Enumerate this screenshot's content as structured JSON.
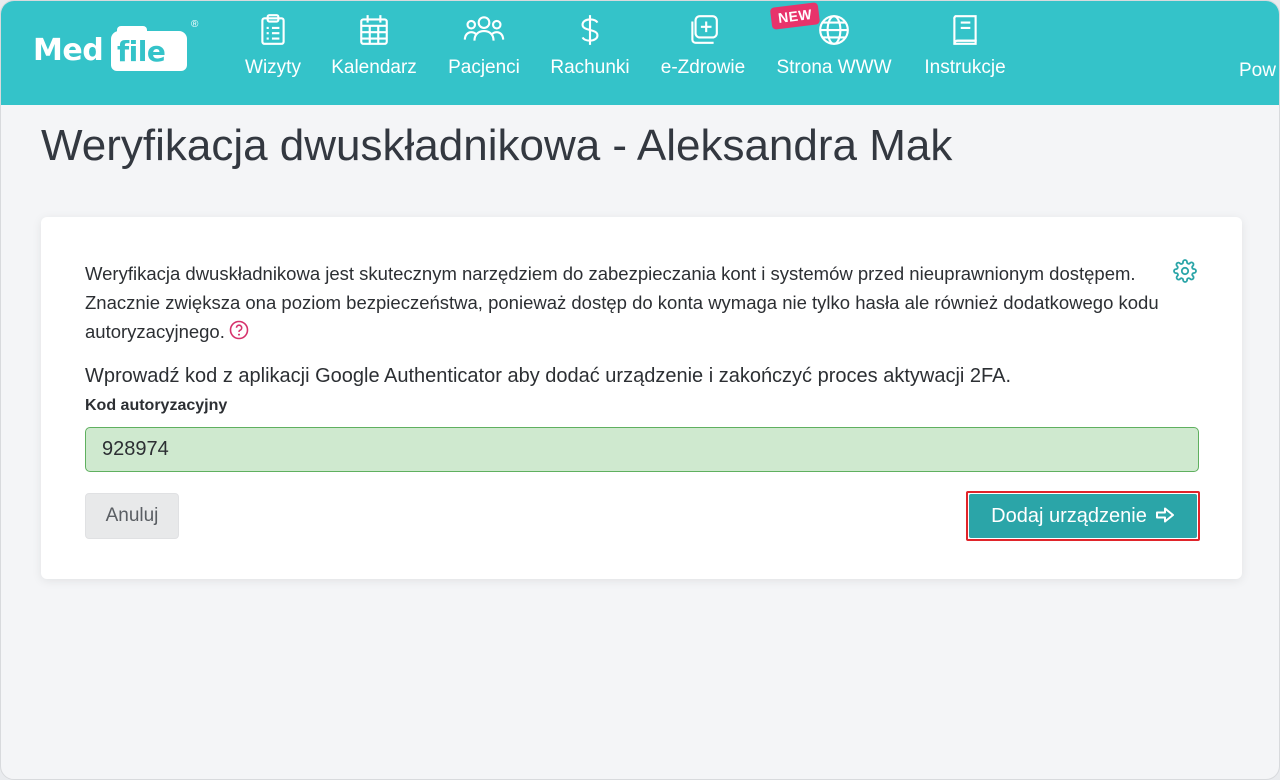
{
  "brand": {
    "logo_part1": "Med",
    "logo_part2": "file",
    "registered": "®"
  },
  "nav": {
    "items": [
      {
        "label": "Wizyty",
        "icon": "clipboard-icon"
      },
      {
        "label": "Kalendarz",
        "icon": "calendar-icon"
      },
      {
        "label": "Pacjenci",
        "icon": "users-icon"
      },
      {
        "label": "Rachunki",
        "icon": "dollar-icon"
      },
      {
        "label": "e-Zdrowie",
        "icon": "medical-plus-icon"
      },
      {
        "label": "Strona WWW",
        "icon": "globe-icon"
      },
      {
        "label": "Instrukcje",
        "icon": "book-icon"
      }
    ],
    "new_badge": "NEW",
    "cut_off_label": "Pow"
  },
  "page": {
    "title": "Weryfikacja dwuskładnikowa - Aleksandra Mak"
  },
  "card": {
    "description": "Weryfikacja dwuskładnikowa jest skutecznym narzędziem do zabezpieczania kont i systemów przed nieuprawnionym dostępem. Znacznie zwiększa ona poziom bezpieczeństwa, ponieważ dostęp do konta wymaga nie tylko hasła ale również dodatkowego kodu autoryzacyjnego.",
    "instruction": "Wprowadź kod z aplikacji Google Authenticator aby dodać urządzenie i zakończyć proces aktywacji 2FA.",
    "code_label": "Kod autoryzacyjny",
    "code_value": "928974",
    "cancel_label": "Anuluj",
    "submit_label": "Dodaj urządzenie"
  },
  "colors": {
    "navbar": "#34c3c9",
    "primary_button": "#2ba5a8",
    "valid_input_bg": "#cfe9cf",
    "highlight_border": "#e0242a",
    "badge": "#e8336b"
  }
}
